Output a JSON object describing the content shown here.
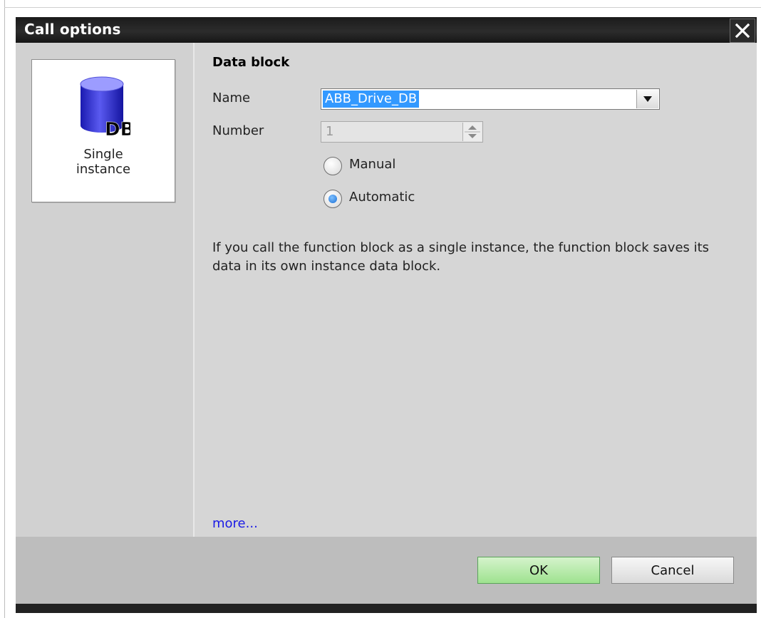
{
  "window": {
    "title": "Call options"
  },
  "sidebar": {
    "tile": {
      "icon_text": "DB",
      "label_line1": "Single",
      "label_line2": "instance",
      "icon": "database-icon"
    }
  },
  "main": {
    "section_title": "Data block",
    "name_label": "Name",
    "name_value": "ABB_Drive_DB",
    "number_label": "Number",
    "number_value": "1",
    "radio_manual": "Manual",
    "radio_automatic": "Automatic",
    "selected_radio": "Automatic",
    "description": "If you call the function block as a single instance, the function block saves its data in its own instance data block.",
    "more_link": "more..."
  },
  "buttons": {
    "ok": "OK",
    "cancel": "Cancel"
  },
  "colors": {
    "titlebar": "#1f1f1f",
    "selection": "#3399ff",
    "ok_button": "#b6eaa8",
    "link": "#1a1ae6"
  }
}
